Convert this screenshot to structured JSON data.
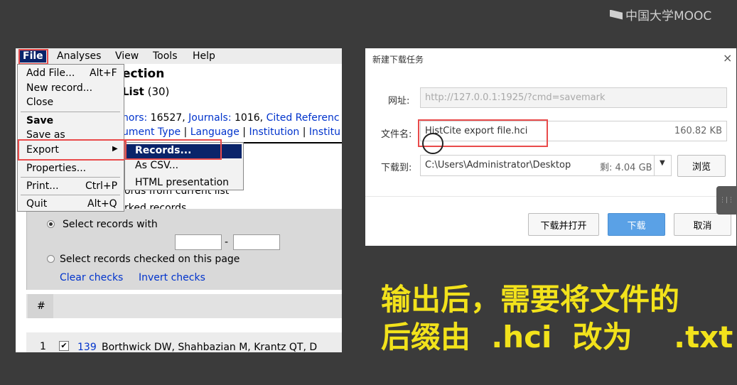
{
  "watermark": "中国大学MOOC",
  "histcite": {
    "menubar": [
      "File",
      "Analyses",
      "View",
      "Tools",
      "Help"
    ],
    "file_menu": [
      {
        "label": "Add File...",
        "accel": "Alt+F"
      },
      {
        "label": "New record...",
        "accel": ""
      },
      {
        "label": "Close",
        "accel": ""
      },
      {
        "label": "Save",
        "accel": ""
      },
      {
        "label": "Save as",
        "accel": ""
      },
      {
        "label": "Export",
        "accel": ""
      },
      {
        "label": "Properties...",
        "accel": ""
      },
      {
        "label": "Print...",
        "accel": "Ctrl+P"
      },
      {
        "label": "Quit",
        "accel": "Alt+Q"
      }
    ],
    "export_submenu": [
      "Records...",
      "As CSV...",
      "HTML presentation"
    ],
    "title_fragment": "ection",
    "list_fragment": "List",
    "list_count": "(30)",
    "stats_authors_label": "hors:",
    "stats_authors": "16527,",
    "stats_journals_label": "Journals:",
    "stats_journals": "1016,",
    "stats_cited": "Cited Referenc",
    "links": [
      "ument Type",
      "Language",
      "Institution",
      "Institu"
    ],
    "line_records_current": "ords from current list",
    "line_marked": "rked records",
    "select_with": "Select records with",
    "dash": "-",
    "select_checked": "Select records checked on this page",
    "clear_checks": "Clear checks",
    "invert_checks": "Invert checks",
    "col_hash": "#",
    "row1_num": "1",
    "row1_link": "139",
    "row1_text": "Borthwick DW, Shahbazian M, Krantz QT, D"
  },
  "dialog": {
    "title": "新建下载任务",
    "close": "×",
    "url_label": "网址:",
    "url_value": "http://127.0.0.1:1925/?cmd=savemark",
    "name_label": "文件名:",
    "name_value": "HistCite export file.hci",
    "size": "160.82 KB",
    "to_label": "下载到:",
    "path": "C:\\Users\\Administrator\\Desktop",
    "free": "剩: 4.04 GB",
    "browse": "浏览",
    "open_btn": "下载并打开",
    "download_btn": "下载",
    "cancel_btn": "取消"
  },
  "caption": {
    "line1": "输出后，需要将文件的",
    "line2": "后缀由  .hci  改为    .txt"
  },
  "colors": {
    "highlight_red": "#e94b4b",
    "caption_yellow": "#f2e21b",
    "menu_select": "#0a246a",
    "primary_button": "#5aa1e6"
  }
}
